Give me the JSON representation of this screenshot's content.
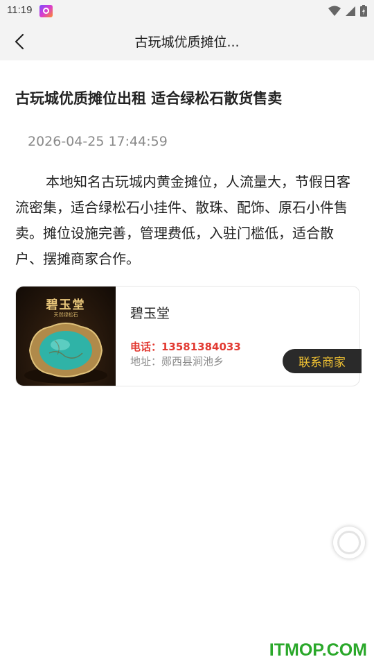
{
  "status_bar": {
    "time": "11:19",
    "app_icon": "app-notification-icon",
    "wifi_icon": "wifi-icon",
    "signal_icon": "signal-icon",
    "battery_icon": "battery-charging-icon"
  },
  "nav": {
    "back_icon": "chevron-left-icon",
    "title": "古玩城优质摊位..."
  },
  "article": {
    "title": "古玩城优质摊位出租 适合绿松石散货售卖",
    "date": "2026-04-25 17:44:59",
    "body": "本地知名古玩城内黄金摊位，人流量大，节假日客流密集，适合绿松石小挂件、散珠、配饰、原石小件售卖。摊位设施完善，管理费低，入驻门槛低，适合散户、摆摊商家合作。"
  },
  "merchant": {
    "image_brand": "碧玉堂",
    "image_sub": "天然绿松石",
    "name": "碧玉堂",
    "phone": "电话：13581384033",
    "address": "地址：郧西县涧池乡",
    "contact_label": "联系商家"
  },
  "watermark": "ITMOP.COM",
  "colors": {
    "phone": "#e23a32",
    "contact_text": "#f1c232",
    "contact_bg": "#2a2a2a",
    "watermark": "#2aa82a"
  }
}
